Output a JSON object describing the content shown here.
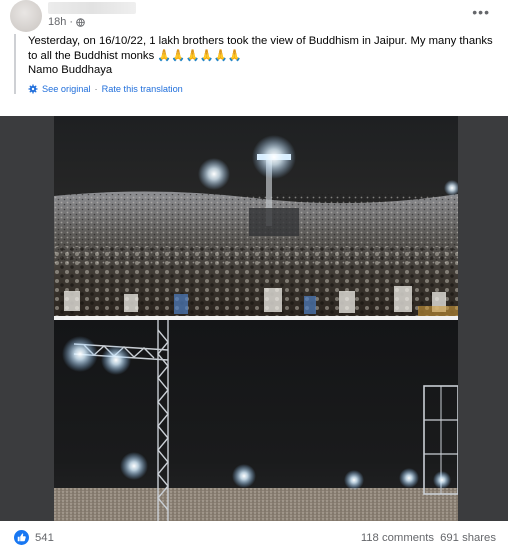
{
  "post": {
    "timestamp": "18h",
    "privacy_icon": "globe-icon",
    "more_label": "•••",
    "lines": [
      "Yesterday, on 16/10/22, 1 lakh brothers took the view of Buddhism in Jaipur. My many thanks",
      "to all the Buddhist monks 🙏🙏🙏🙏🙏🙏",
      "Namo Buddhaya"
    ],
    "translation": {
      "see_original": "See original",
      "separator": "·",
      "rate": "Rate this translation"
    }
  },
  "footer": {
    "reaction_icon": "like-icon",
    "reaction_count": "541",
    "comments": "118 comments",
    "shares": "691 shares"
  },
  "colors": {
    "link": "#216fdb",
    "secondary_text": "#65676b",
    "like_blue": "#1877f2",
    "photo_frame": "#3b3c3e"
  }
}
